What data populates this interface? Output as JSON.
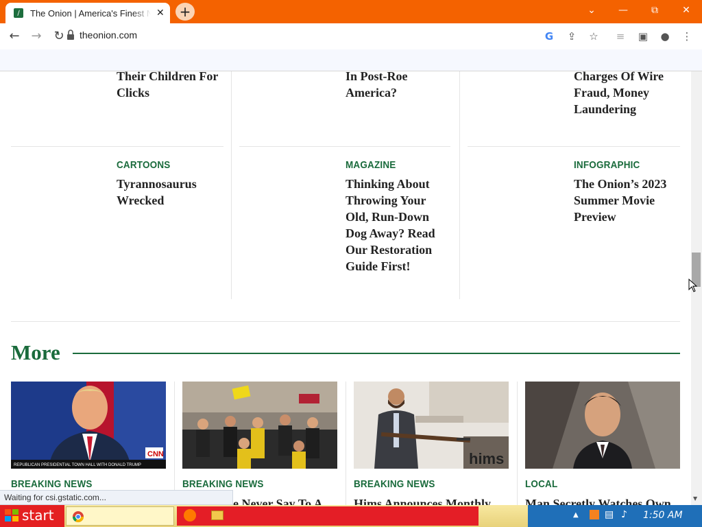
{
  "browser": {
    "tab_title": "The Onion | America's Finest News Source",
    "new_tab_label": "+",
    "url": "theonion.com"
  },
  "articles_top": [
    {
      "headline_tail": "Their Children For Clicks"
    },
    {
      "headline_tail": "In Post-Roe America?"
    },
    {
      "headline_tail": "Charges Of Wire Fraud, Money Laundering"
    }
  ],
  "articles_mid": [
    {
      "category": "CARTOONS",
      "headline": "Tyrannosaurus Wrecked"
    },
    {
      "category": "MAGAZINE",
      "headline": "Thinking About Throwing Your Old, Run-Down Dog Away? Read Our Restoration Guide First!"
    },
    {
      "category": "INFOGRAPHIC",
      "headline": "The Onion’s 2023 Summer Movie Preview"
    }
  ],
  "more_section": {
    "title": "More",
    "cards": [
      {
        "category": "BREAKING NEWS",
        "headline_partial": "",
        "thumb_caption": "REPUBLICAN PRESIDENTIAL TOWN HALL WITH DONALD TRUMP",
        "thumb_logo": "CNN"
      },
      {
        "category": "BREAKING NEWS",
        "headline_partial": "e Never Say To A",
        "thumb_caption": "",
        "thumb_logo": ""
      },
      {
        "category": "BREAKING NEWS",
        "headline_partial": "Hims Announces Monthly",
        "thumb_caption": "",
        "thumb_logo": "hims"
      },
      {
        "category": "LOCAL",
        "headline_partial": "Man Secretly Watches Own",
        "thumb_caption": "",
        "thumb_logo": ""
      }
    ]
  },
  "status_bar": {
    "text": "Waiting for csi.gstatic.com..."
  },
  "taskbar": {
    "start_label": "start",
    "clock": "1:50 AM"
  },
  "colors": {
    "accent": "#1a6b3c",
    "titlebar": "#f46200",
    "start": "#e42021"
  }
}
